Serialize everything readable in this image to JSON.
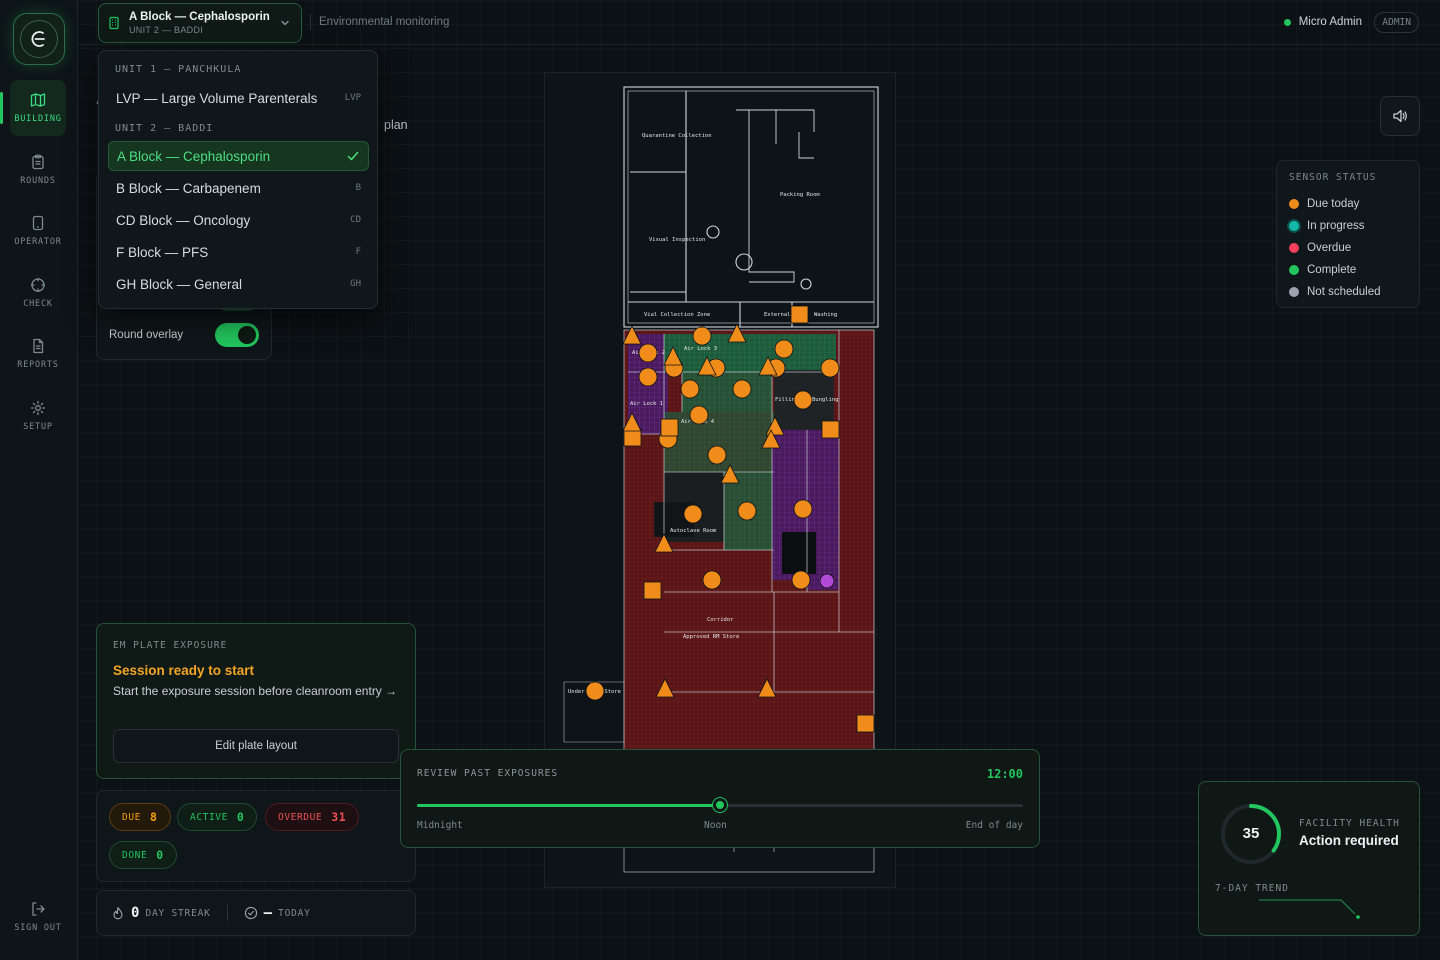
{
  "app": {
    "logo_glyph": "E",
    "brand_color": "#22c55e"
  },
  "header": {
    "block_title": "A Block — Cephalosporin",
    "block_subtitle": "UNIT 2 — BADDI",
    "section_title": "Environmental monitoring",
    "user_name": "Micro Admin",
    "role_badge": "ADMIN"
  },
  "sidebar": {
    "items": [
      {
        "label": "BUILDING",
        "icon": "map-icon",
        "active": true
      },
      {
        "label": "ROUNDS",
        "icon": "clipboard-icon",
        "active": false
      },
      {
        "label": "OPERATOR",
        "icon": "tablet-icon",
        "active": false
      },
      {
        "label": "CHECK",
        "icon": "crosshair-icon",
        "active": false
      },
      {
        "label": "REPORTS",
        "icon": "document-icon",
        "active": false
      },
      {
        "label": "SETUP",
        "icon": "gear-icon",
        "active": false
      }
    ],
    "sign_out": "SIGN OUT"
  },
  "dropdown": {
    "groups": [
      {
        "label": "UNIT 1 — PANCHKULA",
        "items": [
          {
            "label": "LVP — Large Volume Parenterals",
            "code": "LVP",
            "selected": false
          }
        ]
      },
      {
        "label": "UNIT 2 — BADDI",
        "items": [
          {
            "label": "A Block — Cephalosporin",
            "code": "",
            "selected": true
          },
          {
            "label": "B Block — Carbapenem",
            "code": "B",
            "selected": false
          },
          {
            "label": "CD Block — Oncology",
            "code": "CD",
            "selected": false
          },
          {
            "label": "F Block — PFS",
            "code": "F",
            "selected": false
          },
          {
            "label": "GH Block — General",
            "code": "GH",
            "selected": false
          }
        ]
      }
    ]
  },
  "page": {
    "heading_letter": "A",
    "hint_trailing": "plan"
  },
  "overlays": {
    "round_overlay_label": "Round overlay"
  },
  "floor_plan": {
    "rooms": [
      "Quarantine Collection",
      "Packing Room",
      "Visual Inspection",
      "Vial Collection Zone",
      "External",
      "Washing",
      "Air Lock 3",
      "Air Lock 2",
      "Air Lock 1",
      "Air Lock 4",
      "Filling",
      "Bungling",
      "Corridor",
      "Autoclave Room",
      "Approved RM Store",
      "Under Test Store"
    ]
  },
  "legend": {
    "title": "SENSOR STATUS",
    "items": [
      {
        "label": "Due today",
        "color": "#f08c1a"
      },
      {
        "label": "In progress",
        "color": "#14b8a6"
      },
      {
        "label": "Overdue",
        "color": "#f43f5e"
      },
      {
        "label": "Complete",
        "color": "#22c55e"
      },
      {
        "label": "Not scheduled",
        "color": "#9ca3af"
      }
    ]
  },
  "em_plate": {
    "eyebrow": "EM PLATE EXPOSURE",
    "title": "Session ready to start",
    "description": "Start the exposure session before cleanroom entry →",
    "edit_button": "Edit plate layout"
  },
  "counts": {
    "due_label": "DUE",
    "due": "8",
    "active_label": "ACTIVE",
    "active": "0",
    "overdue_label": "OVERDUE",
    "overdue": "31",
    "done_label": "DONE",
    "done": "0"
  },
  "streak": {
    "days": "0",
    "days_label": "DAY STREAK",
    "today_value": "–",
    "today_label": "TODAY"
  },
  "timeline": {
    "title": "REVIEW PAST EXPOSURES",
    "current_time": "12:00",
    "progress": 0.5,
    "start_label": "Midnight",
    "mid_label": "Noon",
    "end_label": "End of day"
  },
  "health": {
    "score": "35",
    "score_fraction": 0.35,
    "eyebrow": "FACILITY HEALTH",
    "status": "Action required",
    "trend_label": "7-DAY TREND"
  }
}
